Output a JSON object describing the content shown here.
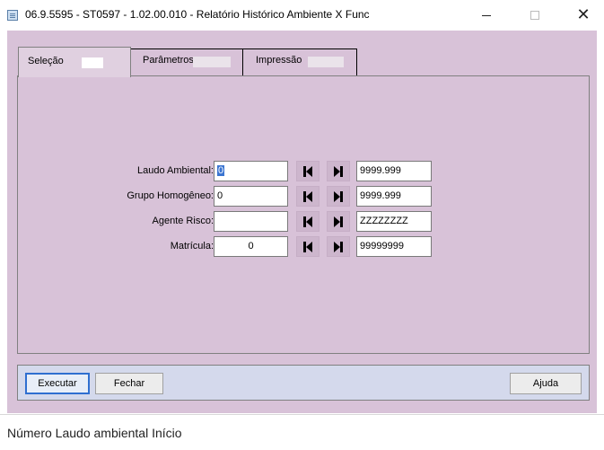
{
  "window": {
    "title": "06.9.5595 - ST0597 - 1.02.00.010 - Relatório Histórico Ambiente X Func",
    "close_glyph": "✕"
  },
  "tabs": [
    {
      "label": "Seleção",
      "active": true
    },
    {
      "label": "Parâmetros",
      "active": false
    },
    {
      "label": "Impressão",
      "active": false
    }
  ],
  "fields": [
    {
      "label": "Laudo Ambiental:",
      "from_value": "0",
      "to_value": "9999.999"
    },
    {
      "label": "Grupo Homogêneo:",
      "from_value": "0",
      "to_value": "9999.999"
    },
    {
      "label": "Agente Risco:",
      "from_value": "",
      "to_value": "ZZZZZZZZ"
    },
    {
      "label": "Matrícula:",
      "from_value": "0",
      "to_value": "99999999"
    }
  ],
  "buttons": {
    "execute": "Executar",
    "close": "Fechar",
    "help": "Ajuda"
  },
  "status": {
    "text": "Número Laudo ambiental Início"
  },
  "colors": {
    "form_background": "#d8c2d8",
    "button_bar": "#d4d9ec",
    "focus_border": "#2f6fd0",
    "selection": "#3b75d1"
  }
}
